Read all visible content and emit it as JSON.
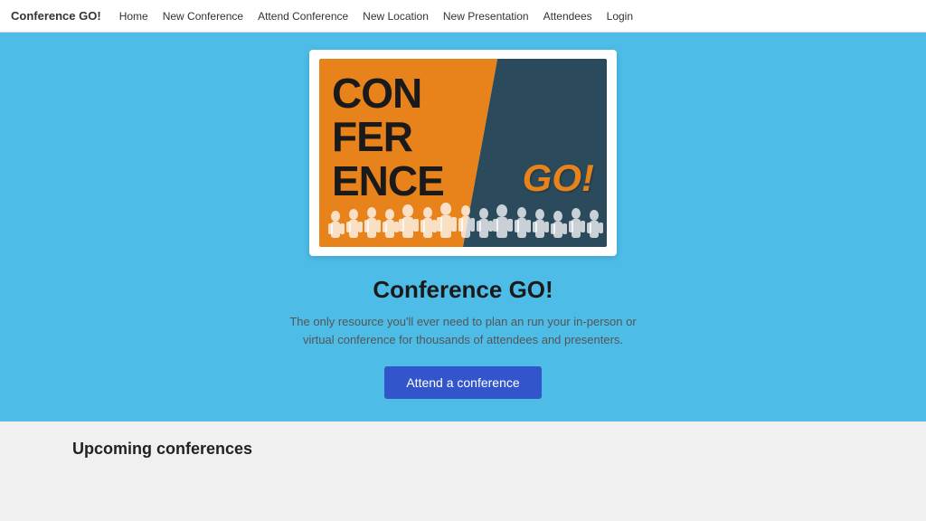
{
  "navbar": {
    "brand": "Conference GO!",
    "links": [
      {
        "id": "home",
        "label": "Home"
      },
      {
        "id": "new-conference",
        "label": "New Conference"
      },
      {
        "id": "attend-conference",
        "label": "Attend Conference"
      },
      {
        "id": "new-location",
        "label": "New Location"
      },
      {
        "id": "new-presentation",
        "label": "New Presentation"
      },
      {
        "id": "attendees",
        "label": "Attendees"
      },
      {
        "id": "login",
        "label": "Login"
      }
    ]
  },
  "hero": {
    "title": "Conference GO!",
    "subtitle": "The only resource you'll ever need to plan an run your in-person or virtual conference for thousands of attendees and presenters.",
    "attend_button": "Attend a conference"
  },
  "bottom": {
    "upcoming_title": "Upcoming conferences"
  }
}
